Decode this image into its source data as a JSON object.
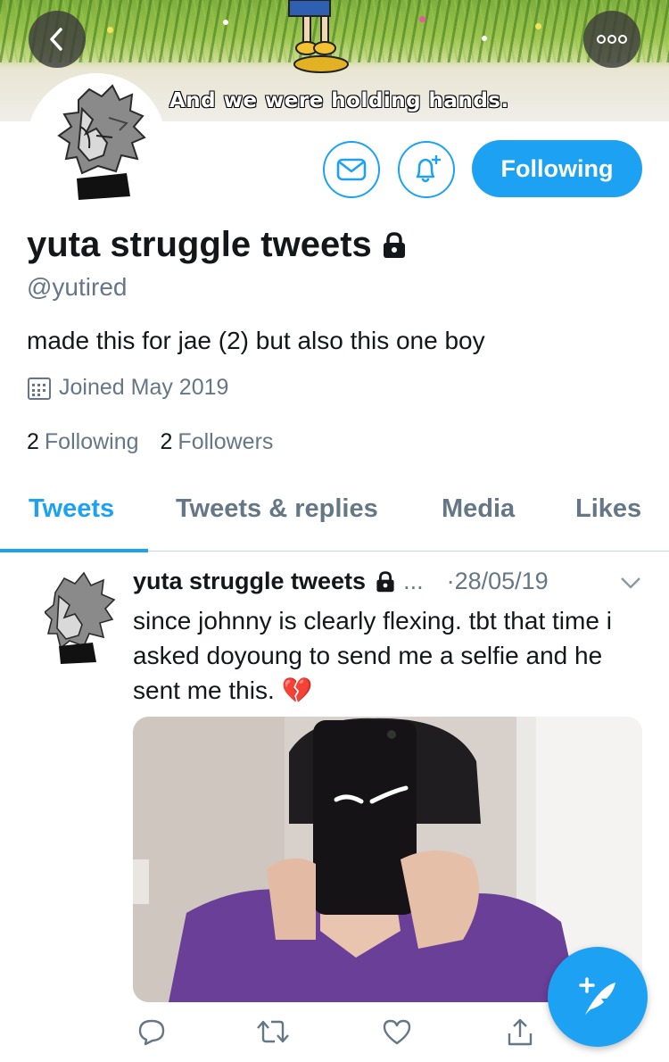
{
  "header": {
    "banner_caption": "And we were holding hands.",
    "back_icon": "chevron-left-icon",
    "more_icon": "more-icon"
  },
  "profile": {
    "display_name": "yuta struggle tweets",
    "protected_icon": "lock-icon",
    "handle": "@yutired",
    "bio": "made this for jae (2) but also this one boy",
    "joined": "Joined May 2019",
    "following_count": "2",
    "following_label": "Following",
    "followers_count": "2",
    "followers_label": "Followers",
    "follow_button_label": "Following"
  },
  "tabs": [
    {
      "label": "Tweets",
      "active": true
    },
    {
      "label": "Tweets & replies",
      "active": false
    },
    {
      "label": "Media",
      "active": false
    },
    {
      "label": "Likes",
      "active": false
    }
  ],
  "tweet": {
    "author": "yuta struggle tweets",
    "ellipsis": "...",
    "date": "·28/05/19",
    "text": "since johnny is clearly flexing. tbt that time i asked doyoung to send me a selfie and he sent me this. 💔"
  },
  "colors": {
    "accent": "#1da1f2",
    "secondary_text": "#657786",
    "primary_text": "#14171a"
  }
}
